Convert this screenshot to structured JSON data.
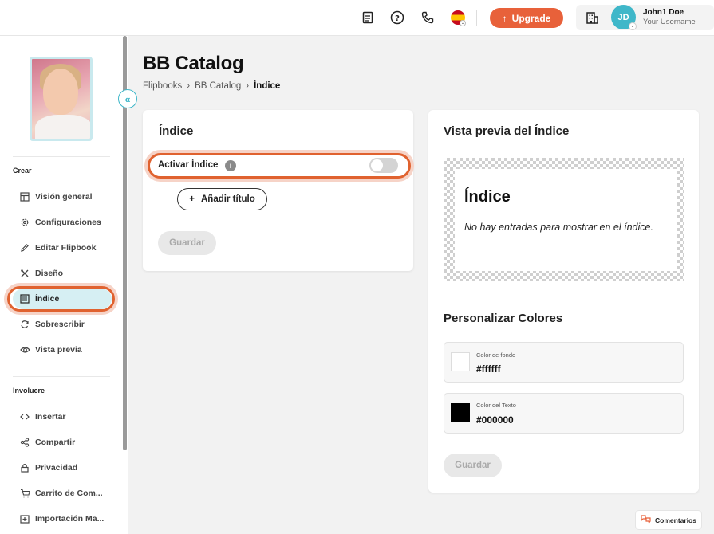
{
  "topbar": {
    "upgrade_label": "Upgrade",
    "user": {
      "initials": "JD",
      "name": "John1 Doe",
      "username": "Your Username"
    }
  },
  "sidebar": {
    "section_create": "Crear",
    "section_involve": "Involucre",
    "items_create": [
      {
        "label": "Visión general",
        "icon": "layout-icon"
      },
      {
        "label": "Configuraciones",
        "icon": "gear-icon"
      },
      {
        "label": "Editar Flipbook",
        "icon": "pencil-icon"
      },
      {
        "label": "Diseño",
        "icon": "tools-icon"
      },
      {
        "label": "Índice",
        "icon": "list-icon",
        "active": true
      },
      {
        "label": "Sobrescribir",
        "icon": "refresh-icon"
      },
      {
        "label": "Vista previa",
        "icon": "eye-icon"
      }
    ],
    "items_involve": [
      {
        "label": "Insertar",
        "icon": "code-icon"
      },
      {
        "label": "Compartir",
        "icon": "share-icon"
      },
      {
        "label": "Privacidad",
        "icon": "lock-icon"
      },
      {
        "label": "Carrito de Com...",
        "icon": "cart-icon"
      },
      {
        "label": "Importación Ma...",
        "icon": "import-icon"
      }
    ]
  },
  "page": {
    "title": "BB Catalog",
    "breadcrumb": [
      "Flipbooks",
      "BB Catalog",
      "Índice"
    ]
  },
  "index_card": {
    "title": "Índice",
    "toggle_label": "Activar Índice",
    "toggle_on": false,
    "add_title_label": "Añadir título",
    "save_label": "Guardar"
  },
  "preview_card": {
    "title": "Vista previa del Índice",
    "preview_heading": "Índice",
    "empty_text": "No hay entradas para mostrar en el índice.",
    "colors_title": "Personalizar Colores",
    "bg_caption": "Color de fondo",
    "bg_value": "#ffffff",
    "text_caption": "Color del Texto",
    "text_value": "#000000",
    "save_label": "Guardar"
  },
  "comments_label": "Comentarios",
  "colors": {
    "accent": "#e8613a",
    "teal": "#3fb7c9"
  }
}
